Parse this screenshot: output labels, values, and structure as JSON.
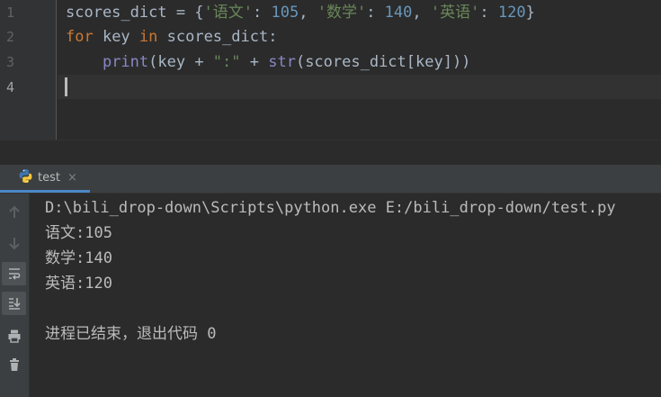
{
  "editor": {
    "line_numbers": [
      "1",
      "2",
      "3",
      "4"
    ],
    "line1": {
      "p1": "scores_dict = {",
      "s1": "'语文'",
      "p2": ": ",
      "n1": "105",
      "p3": ", ",
      "s2": "'数学'",
      "p4": ": ",
      "n2": "140",
      "p5": ", ",
      "s3": "'英语'",
      "p6": ": ",
      "n3": "120",
      "p7": "}"
    },
    "line2": {
      "k1": "for",
      "p1": " key ",
      "k2": "in",
      "p2": " scores_dict:"
    },
    "line3": {
      "indent": "    ",
      "b1": "print",
      "p1": "(key + ",
      "s1": "\":\"",
      "p2": " + ",
      "b2": "str",
      "p3": "(scores_dict[key]))"
    }
  },
  "run_panel": {
    "tab_label": "test",
    "close_glyph": "×",
    "icons": [
      "up-arrow-icon",
      "down-arrow-icon",
      "soft-wrap-icon",
      "scroll-to-end-icon",
      "print-icon",
      "trash-icon"
    ]
  },
  "console": {
    "lines": [
      "D:\\bili_drop-down\\Scripts\\python.exe E:/bili_drop-down/test.py",
      "语文:105",
      "数学:140",
      "英语:120",
      "",
      "进程已结束，退出代码 0"
    ]
  },
  "colors": {
    "background": "#2b2b2b",
    "keyword": "#cc7832",
    "string": "#6a8759",
    "number": "#6897bb",
    "builtin": "#8888c6",
    "text": "#a9b7c6",
    "tab_underline": "#4a88c7"
  }
}
